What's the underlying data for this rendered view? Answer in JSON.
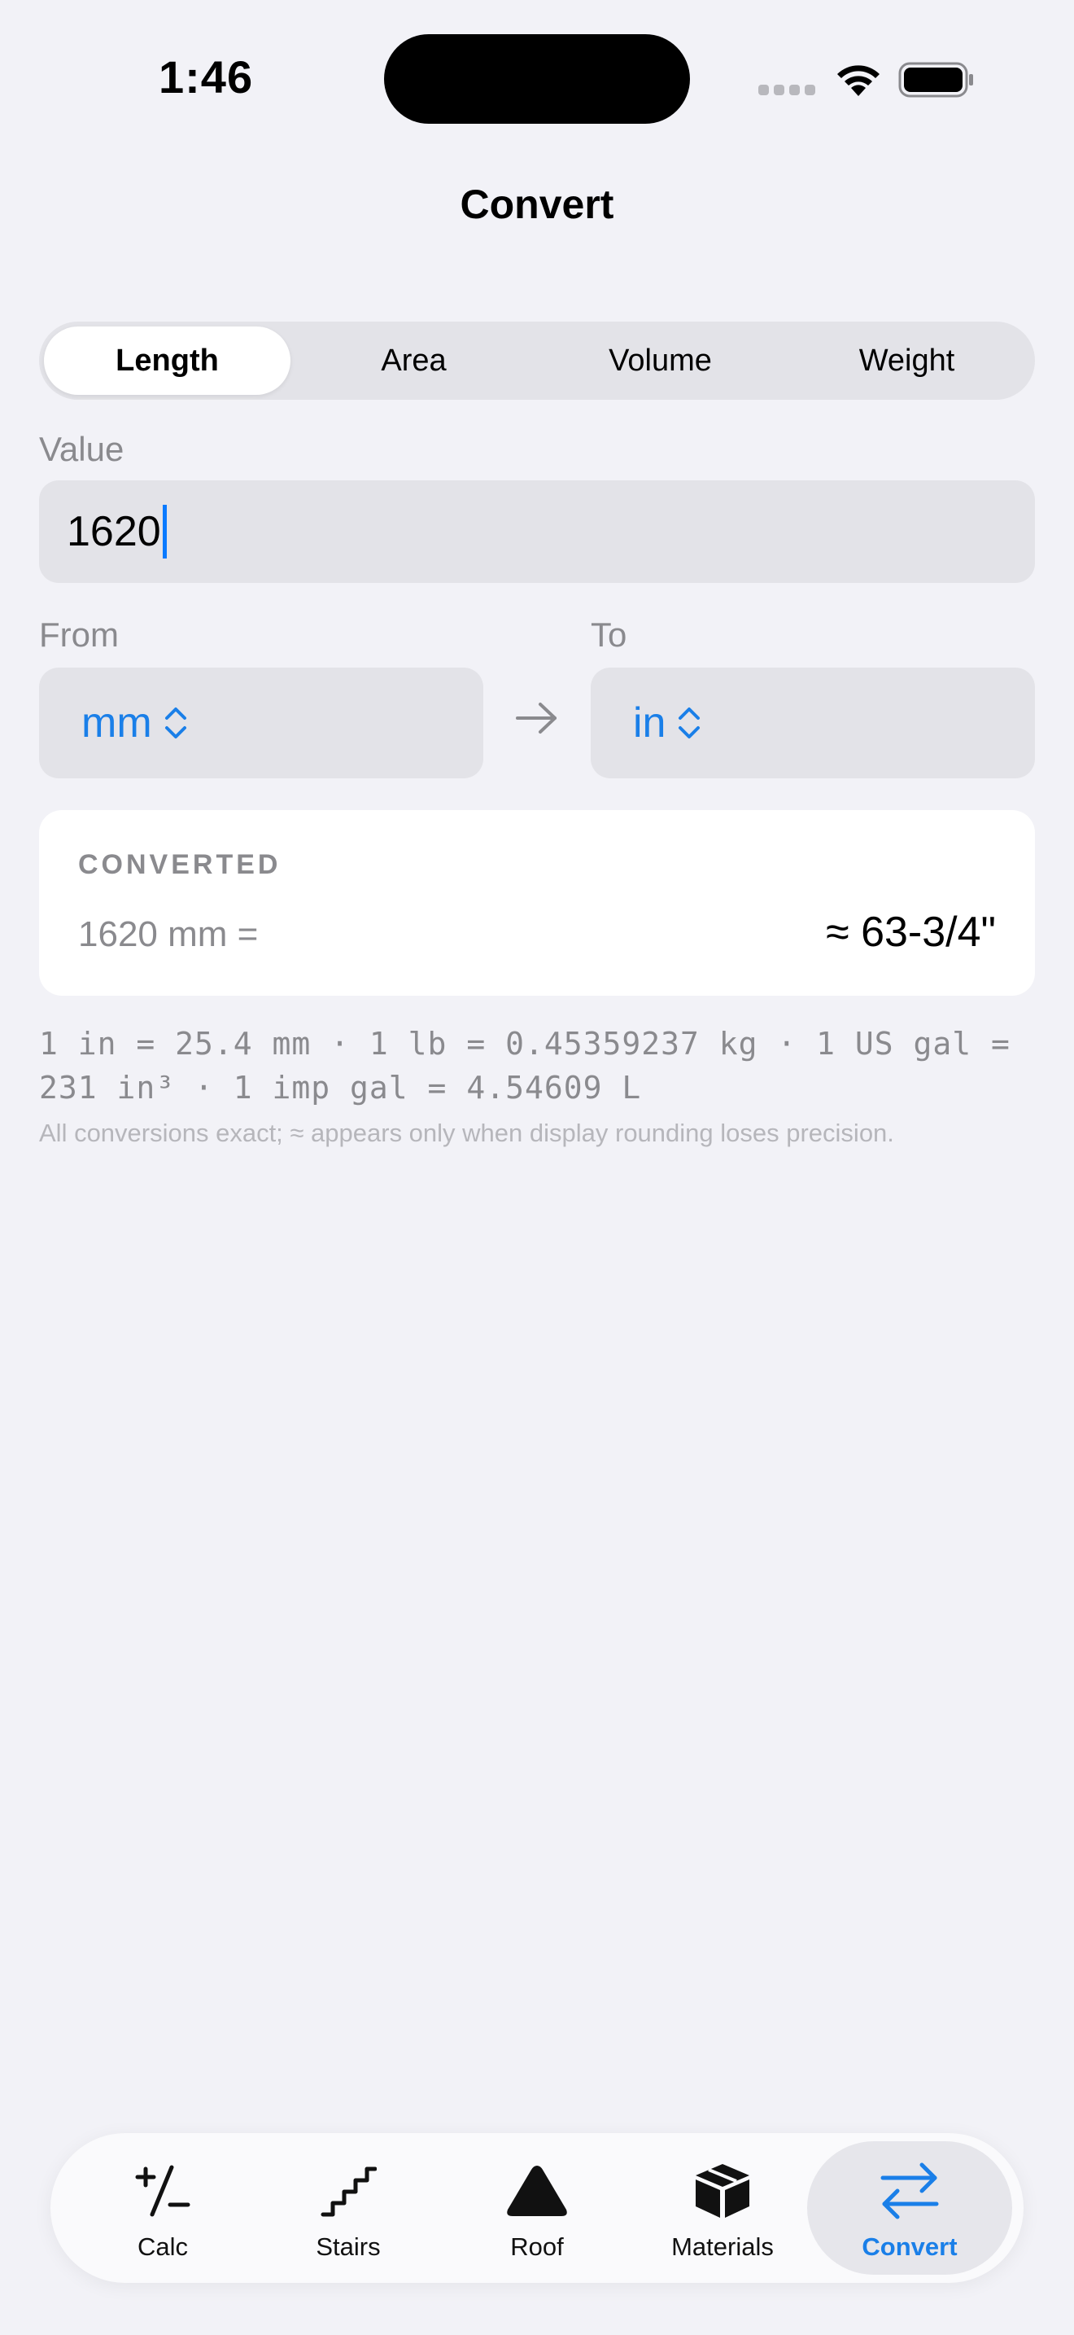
{
  "status": {
    "time": "1:46"
  },
  "nav": {
    "title": "Convert"
  },
  "segments": [
    {
      "label": "Length",
      "active": true
    },
    {
      "label": "Area",
      "active": false
    },
    {
      "label": "Volume",
      "active": false
    },
    {
      "label": "Weight",
      "active": false
    }
  ],
  "value_field": {
    "label": "Value",
    "value": "1620"
  },
  "from": {
    "label": "From",
    "unit": "mm"
  },
  "to": {
    "label": "To",
    "unit": "in"
  },
  "result": {
    "heading": "CONVERTED",
    "lhs": "1620 mm =",
    "rhs": "≈ 63-3/4\""
  },
  "footnote": {
    "constants_line1": "1 in = 25.4 mm · 1 lb = 0.45359237 kg · 1 US gal =",
    "constants_line2": "231 in³ · 1 imp gal = 4.54609 L",
    "note": "All conversions exact; ≈ appears only when display rounding loses precision."
  },
  "tabs": [
    {
      "label": "Calc",
      "icon": "plus-slash-minus-icon",
      "active": false
    },
    {
      "label": "Stairs",
      "icon": "stairs-icon",
      "active": false
    },
    {
      "label": "Roof",
      "icon": "triangle-icon",
      "active": false
    },
    {
      "label": "Materials",
      "icon": "box-icon",
      "active": false
    },
    {
      "label": "Convert",
      "icon": "swap-arrows-icon",
      "active": true
    }
  ],
  "colors": {
    "accent": "#1A7FE8",
    "background": "#F2F2F7",
    "field": "#E3E3E8"
  }
}
